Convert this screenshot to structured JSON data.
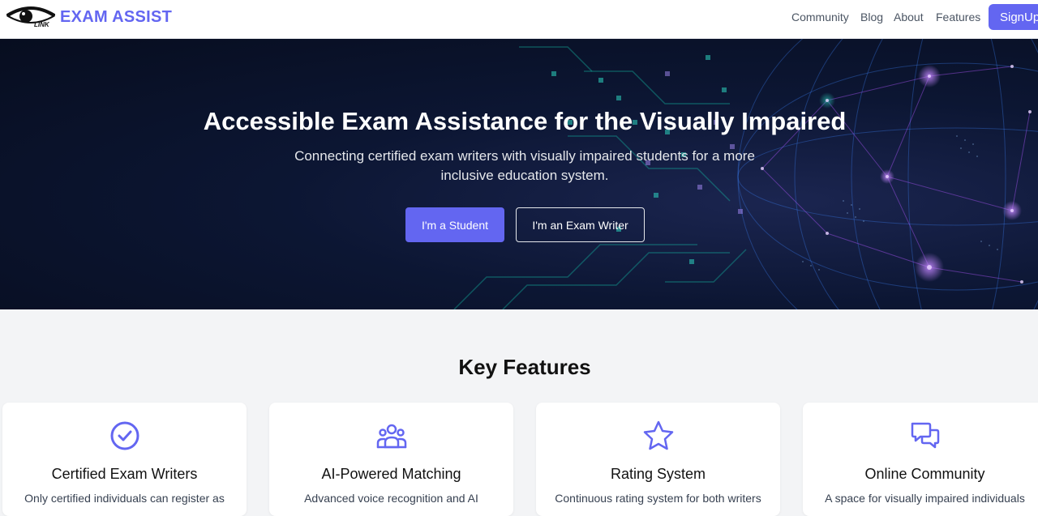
{
  "brand": {
    "name": "EXAM ASSIST",
    "logo_text": "LINK",
    "logo_icon": "eye-icon"
  },
  "nav": {
    "links": [
      "Community",
      "Blog",
      "About",
      "Features"
    ],
    "signup_label": "SignUp"
  },
  "hero": {
    "title": "Accessible Exam Assistance for the Visually Impaired",
    "subtitle": "Connecting certified exam writers with visually impaired students for a more inclusive education system.",
    "student_button": "I'm a Student",
    "writer_button": "I'm an Exam Writer"
  },
  "features": {
    "title": "Key Features",
    "cards": [
      {
        "icon": "check-circle-icon",
        "title": "Certified Exam Writers",
        "desc": "Only certified individuals can register as"
      },
      {
        "icon": "users-icon",
        "title": "AI-Powered Matching",
        "desc": "Advanced voice recognition and AI"
      },
      {
        "icon": "star-icon",
        "title": "Rating System",
        "desc": "Continuous rating system for both writers"
      },
      {
        "icon": "chat-icon",
        "title": "Online Community",
        "desc": "A space for visually impaired individuals"
      }
    ]
  },
  "colors": {
    "accent": "#6366f1",
    "hero_bg": "#0c1633"
  }
}
